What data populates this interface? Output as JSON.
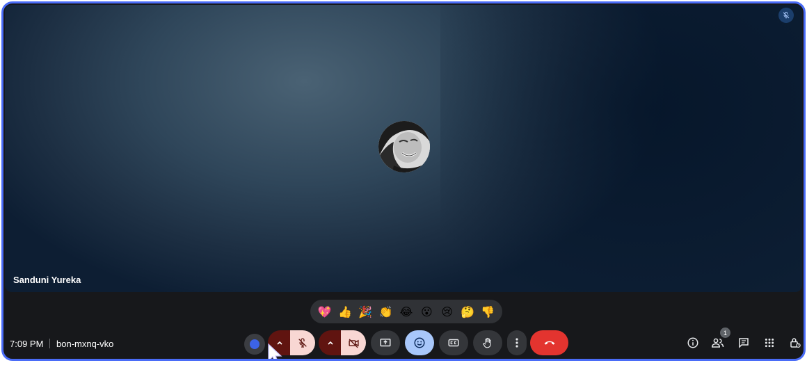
{
  "participant": {
    "name": "Sanduni Yureka"
  },
  "reactions": [
    "💖",
    "👍",
    "🎉",
    "👏",
    "😂",
    "😮",
    "😢",
    "🤔",
    "👎"
  ],
  "meeting": {
    "time": "7:09 PM",
    "code": "bon-mxnq-vko"
  },
  "people": {
    "count": "1"
  },
  "colors": {
    "frame_border": "#4a6cf7",
    "muted_red": "#601410",
    "end_call": "#e3342f",
    "emoji_active": "#a8c7fa"
  }
}
